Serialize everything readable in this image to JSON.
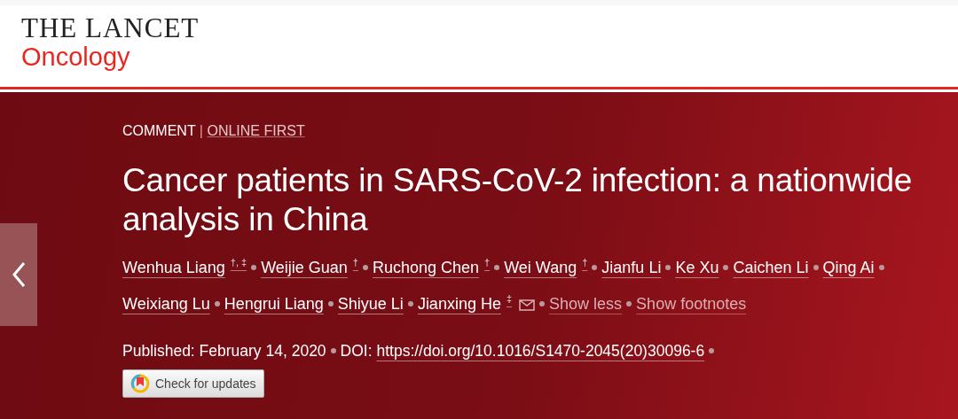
{
  "header": {
    "journal": "THE LANCET",
    "subtitle": "Oncology"
  },
  "article": {
    "type": "COMMENT",
    "separator": "|",
    "section": "ONLINE FIRST",
    "title_lines": [
      "Cancer patients in SARS-CoV-2 infection: a nationwide",
      "analysis in China"
    ],
    "authors": [
      {
        "name": "Wenhua Liang",
        "notes": "†, ‡",
        "email": false
      },
      {
        "name": "Weijie Guan",
        "notes": "†",
        "email": false
      },
      {
        "name": "Ruchong Chen",
        "notes": "†",
        "email": false
      },
      {
        "name": "Wei Wang",
        "notes": "†",
        "email": false
      },
      {
        "name": "Jianfu Li",
        "email": false
      },
      {
        "name": "Ke Xu",
        "email": false
      },
      {
        "name": "Caichen Li",
        "email": false
      },
      {
        "name": "Qing Ai",
        "email": false
      },
      {
        "name": "Weixiang Lu",
        "email": false
      },
      {
        "name": "Hengrui Liang",
        "email": false
      },
      {
        "name": "Shiyue Li",
        "email": false
      },
      {
        "name": "Jianxing He",
        "notes": "‡",
        "email": true
      }
    ],
    "links": [
      "Show less",
      "Show footnotes"
    ],
    "published": "Published: February 14, 2020",
    "doi_label": "DOI:",
    "doi": "https://doi.org/10.1016/S1470-2045(20)30096-6",
    "update_button": "Check for updates"
  }
}
